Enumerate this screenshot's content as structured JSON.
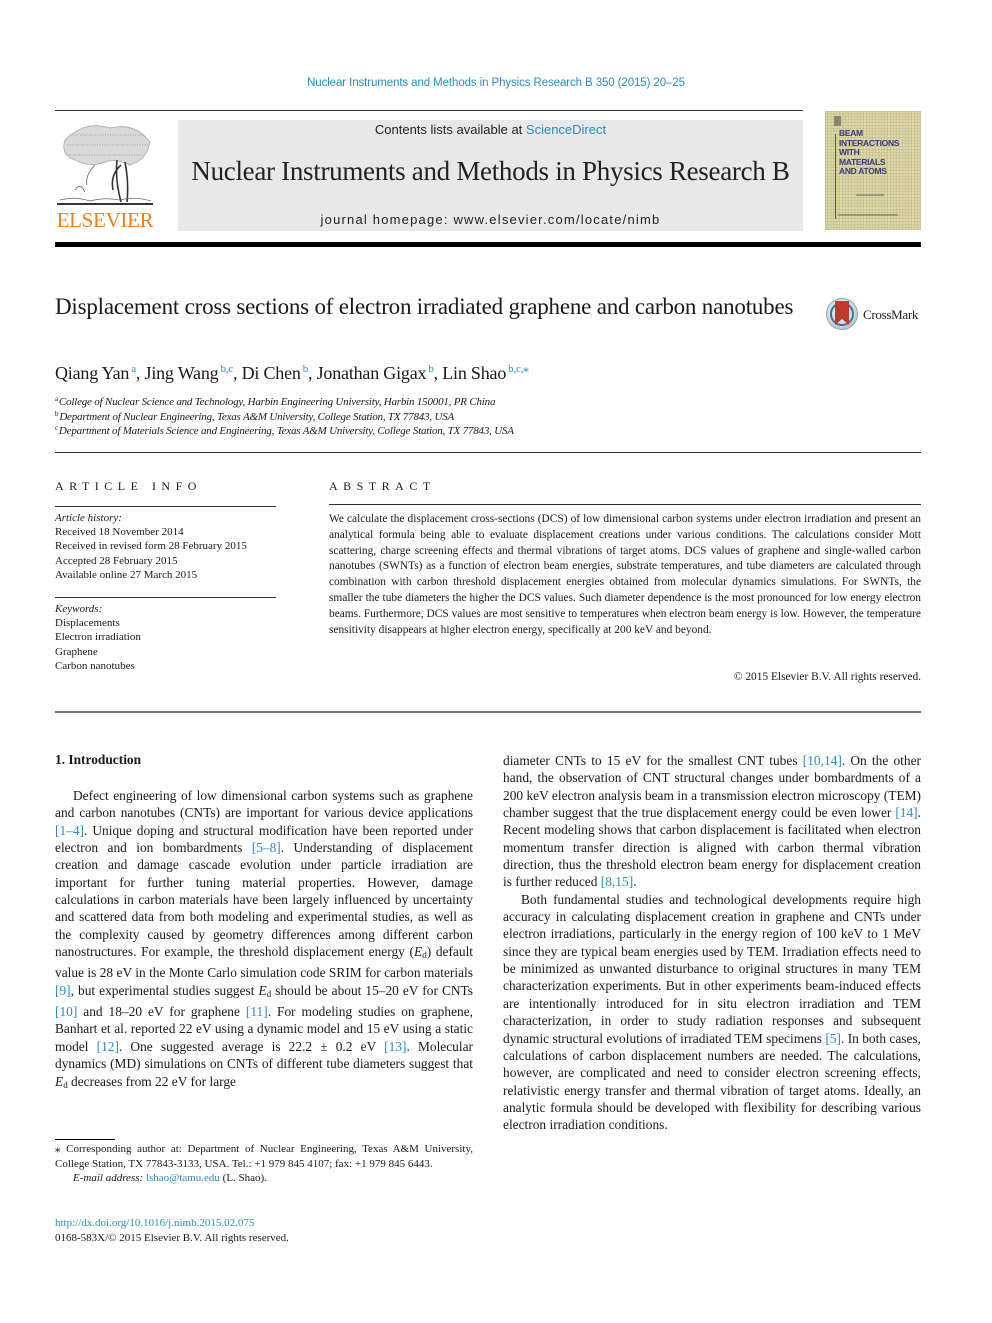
{
  "header": {
    "citation": "Nuclear Instruments and Methods in Physics Research B 350 (2015) 20–25",
    "contents_prefix": "Contents lists available at ",
    "contents_link": "ScienceDirect",
    "journal_title": "Nuclear Instruments and Methods in Physics Research B",
    "homepage_prefix": "journal homepage: ",
    "homepage_url": "www.elsevier.com/locate/nimb",
    "publisher_logo_text": "ELSEVIER",
    "cover_title": [
      "BEAM",
      "INTERACTIONS",
      "WITH",
      "MATERIALS",
      "AND ATOMS"
    ],
    "crossmark_label": "CrossMark"
  },
  "article": {
    "title": "Displacement cross sections of electron irradiated graphene and carbon nanotubes",
    "authors": [
      {
        "name": "Qiang Yan",
        "sup": "a"
      },
      {
        "name": "Jing Wang",
        "sup": "b,c"
      },
      {
        "name": "Di Chen",
        "sup": "b"
      },
      {
        "name": "Jonathan Gigax",
        "sup": "b"
      },
      {
        "name": "Lin Shao",
        "sup": "b,c,⁎"
      }
    ],
    "affiliations": [
      {
        "key": "a",
        "text": "College of Nuclear Science and Technology, Harbin Engineering University, Harbin 150001, PR China"
      },
      {
        "key": "b",
        "text": "Department of Nuclear Engineering, Texas A&M University, College Station, TX 77843, USA"
      },
      {
        "key": "c",
        "text": "Department of Materials Science and Engineering, Texas A&M University, College Station, TX 77843, USA"
      }
    ]
  },
  "article_info": {
    "heading": "ARTICLE INFO",
    "history_label": "Article history:",
    "history": [
      "Received 18 November 2014",
      "Received in revised form 28 February 2015",
      "Accepted 28 February 2015",
      "Available online 27 March 2015"
    ],
    "keywords_label": "Keywords:",
    "keywords": [
      "Displacements",
      "Electron irradiation",
      "Graphene",
      "Carbon nanotubes"
    ]
  },
  "abstract": {
    "heading": "ABSTRACT",
    "text": "We calculate the displacement cross-sections (DCS) of low dimensional carbon systems under electron irradiation and present an analytical formula being able to evaluate displacement creations under various conditions. The calculations consider Mott scattering, charge screening effects and thermal vibrations of target atoms. DCS values of graphene and single-walled carbon nanotubes (SWNTs) as a function of electron beam energies, substrate temperatures, and tube diameters are calculated through combination with carbon threshold displacement energies obtained from molecular dynamics simulations. For SWNTs, the smaller the tube diameters the higher the DCS values. Such diameter dependence is the most pronounced for low energy electron beams. Furthermore, DCS values are most sensitive to temperatures when electron beam energy is low. However, the temperature sensitivity disappears at higher electron energy, specifically at 200 keV and beyond.",
    "copyright": "© 2015 Elsevier B.V. All rights reserved."
  },
  "body": {
    "section_heading": "1. Introduction",
    "left_col": {
      "p1_a": "Defect engineering of low dimensional carbon systems such as graphene and carbon nanotubes (CNTs) are important for various device applications ",
      "ref_1_4": "[1–4]",
      "p1_b": ". Unique doping and structural modification have been reported under electron and ion bombardments ",
      "ref_5_8": "[5–8]",
      "p1_c": ". Understanding of displacement creation and damage cascade evolution under particle irradiation are important for further tuning material properties. However, damage calculations in carbon materials have been largely influenced by uncertainty and scattered data from both modeling and experimental studies, as well as the complexity caused by geometry differences among different carbon nanostructures. For example, the threshold displacement energy (",
      "ed_sym": "E",
      "ed_sub": "d",
      "p1_d": ") default value is 28 eV in the Monte Carlo simulation code SRIM for carbon materials ",
      "ref_9": "[9]",
      "p1_e": ", but experimental studies suggest ",
      "p1_f": " should be about 15–20 eV for CNTs ",
      "ref_10": "[10]",
      "p1_g": " and 18–20 eV for graphene ",
      "ref_11": "[11]",
      "p1_h": ". For modeling studies on graphene, Banhart et al. reported 22 eV using a dynamic model and 15 eV using a static model ",
      "ref_12": "[12]",
      "p1_i": ". One suggested average is 22.2 ± 0.2 eV ",
      "ref_13": "[13]",
      "p1_j": ". Molecular dynamics (MD) simulations on CNTs of different tube diameters suggest that ",
      "p1_k": " decreases from 22 eV for large"
    },
    "right_col": {
      "p1_a": "diameter CNTs to 15 eV for the smallest CNT tubes ",
      "ref_10_14": "[10,14]",
      "p1_b": ". On the other hand, the observation of CNT structural changes under bombardments of a 200 keV electron analysis beam in a transmission electron microscopy (TEM) chamber suggest that the true displacement energy could be even lower ",
      "ref_14": "[14]",
      "p1_c": ". Recent modeling shows that carbon displacement is facilitated when electron momentum transfer direction is aligned with carbon thermal vibration direction, thus the threshold electron beam energy for displacement creation is further reduced ",
      "ref_8_15": "[8,15]",
      "p1_d": ".",
      "p2_a": "Both fundamental studies and technological developments require high accuracy in calculating displacement creation in graphene and CNTs under electron irradiations, particularly in the energy region of 100 keV to 1 MeV since they are typical beam energies used by TEM. Irradiation effects need to be minimized as unwanted disturbance to original structures in many TEM characterization experiments. But in other experiments beam-induced effects are intentionally introduced for in situ electron irradiation and TEM characterization, in order to study radiation responses and subsequent dynamic structural evolutions of irradiated TEM specimens ",
      "ref_5": "[5]",
      "p2_b": ". In both cases, calculations of carbon displacement numbers are needed. The calculations, however, are complicated and need to consider electron screening effects, relativistic energy transfer and thermal vibration of target atoms. Ideally, an analytic formula should be developed with flexibility for describing various electron irradiation conditions."
    }
  },
  "footnotes": {
    "corresponding": "⁎ Corresponding author at: Department of Nuclear Engineering, Texas A&M University, College Station, TX 77843-3133, USA. Tel.: +1 979 845 4107; fax: +1 979 845 6443.",
    "email_label": "E-mail address: ",
    "email": "lshao@tamu.edu",
    "email_suffix": " (L. Shao).",
    "doi": "http://dx.doi.org/10.1016/j.nimb.2015.02.075",
    "issn_line": "0168-583X/© 2015 Elsevier B.V. All rights reserved."
  },
  "colors": {
    "link": "#2a8cbf",
    "elsevier_orange": "#f07d1a",
    "masthead_bg": "#e8e8e8",
    "crossmark_red": "#c0392b"
  }
}
